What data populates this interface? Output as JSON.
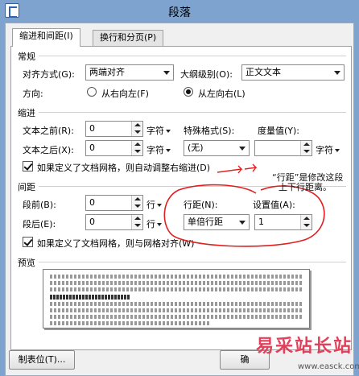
{
  "window": {
    "title": "段落"
  },
  "tabs": [
    {
      "label": "缩进和间距(I)"
    },
    {
      "label": "换行和分页(P)"
    }
  ],
  "general": {
    "section_label": "常规",
    "alignment_label": "对齐方式(G):",
    "alignment_value": "两端对齐",
    "outline_label": "大纲级别(O):",
    "outline_value": "正文文本",
    "direction_label": "方向:",
    "rtl_label": "从右向左(F)",
    "ltr_label": "从左向右(L)",
    "direction_selected": "ltr"
  },
  "indent": {
    "section_label": "缩进",
    "before_label": "文本之前(R):",
    "before_value": "0",
    "before_unit": "字符",
    "after_label": "文本之后(X):",
    "after_value": "0",
    "after_unit": "字符",
    "special_label": "特殊格式(S):",
    "special_value": "(无)",
    "measure_label": "度量值(Y):",
    "measure_value": "",
    "measure_unit": "字符",
    "grid_checkbox_label": "如果定义了文档网格，则自动调整右缩进(D)",
    "grid_checked": true
  },
  "spacing": {
    "section_label": "间距",
    "before_label": "段前(B):",
    "before_value": "0",
    "before_unit": "行",
    "after_label": "段后(E):",
    "after_value": "0",
    "after_unit": "行",
    "line_spacing_label": "行距(N):",
    "line_spacing_value": "单倍行距",
    "setting_label": "设置值(A):",
    "setting_value": "1",
    "grid_checkbox_label": "如果定义了文档网格，则与网格对齐(W)",
    "grid_checked": true
  },
  "preview": {
    "section_label": "预览"
  },
  "annotation": {
    "line1": "“行距”是修改这段",
    "line2": "上下行距离。"
  },
  "buttons": {
    "tabs_label": "制表位(T)...",
    "ok_label": "确"
  },
  "watermark": {
    "text": "易采站长站",
    "url": "www.easck.com"
  },
  "colors": {
    "titlebar": "#7ea3cf",
    "annotation_ink": "#e02020",
    "watermark": "#e0405a"
  }
}
